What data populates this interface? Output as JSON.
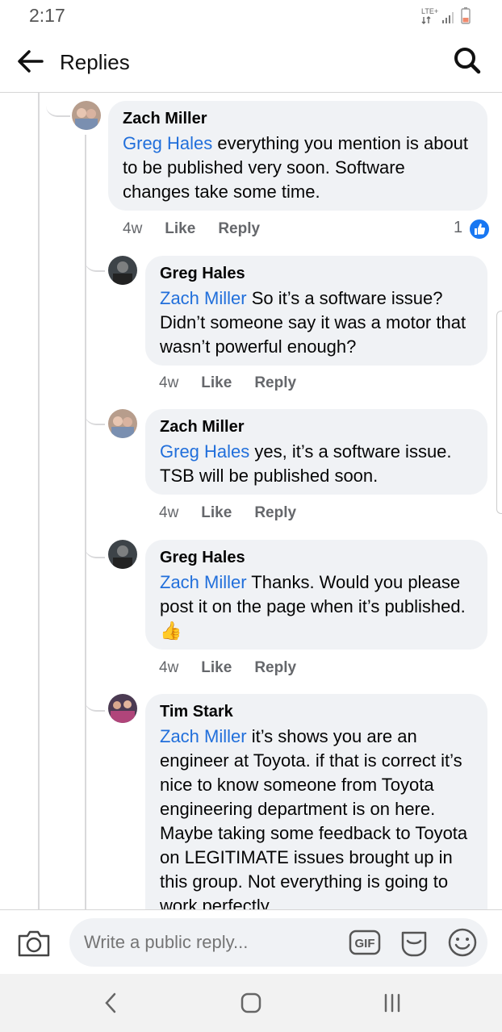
{
  "status": {
    "time": "2:17",
    "network": "LTE+"
  },
  "appbar": {
    "title": "Replies"
  },
  "comments": [
    {
      "author": "Zach Miller",
      "mention": "Greg Hales",
      "text": " everything you mention is about to be published very soon. Software changes take some time.",
      "time": "4w",
      "like": "Like",
      "reply": "Reply",
      "reaction_count": "1"
    },
    {
      "author": "Greg Hales",
      "mention": "Zach Miller",
      "text": " So it’s a software issue? Didn’t someone say it was a motor that wasn’t powerful enough?",
      "time": "4w",
      "like": "Like",
      "reply": "Reply"
    },
    {
      "author": "Zach Miller",
      "mention": "Greg Hales",
      "text": " yes, it’s a software issue. TSB will be published soon.",
      "time": "4w",
      "like": "Like",
      "reply": "Reply"
    },
    {
      "author": "Greg Hales",
      "mention": "Zach Miller",
      "text": " Thanks. Would you please post it on the page when it’s published. 👍",
      "time": "4w",
      "like": "Like",
      "reply": "Reply"
    },
    {
      "author": "Tim Stark",
      "mention": "Zach Miller",
      "text": " it’s shows you are an engineer at Toyota. if that is correct it’s nice to know someone from Toyota engineering department is on here. Maybe taking some feedback to Toyota on LEGITIMATE issues brought up in this group. Not everything is going to work perfectly"
    }
  ],
  "composer": {
    "placeholder": "Write a public reply..."
  },
  "icons": [
    "back-arrow-icon",
    "search-icon",
    "camera-icon",
    "gif-icon",
    "sticker-icon",
    "emoji-icon",
    "like-icon",
    "nav-back-icon",
    "nav-home-icon",
    "nav-recent-icon"
  ],
  "colors": {
    "mention": "#216fdb",
    "bubble": "#f0f2f5",
    "like_blue": "#1877f2"
  }
}
